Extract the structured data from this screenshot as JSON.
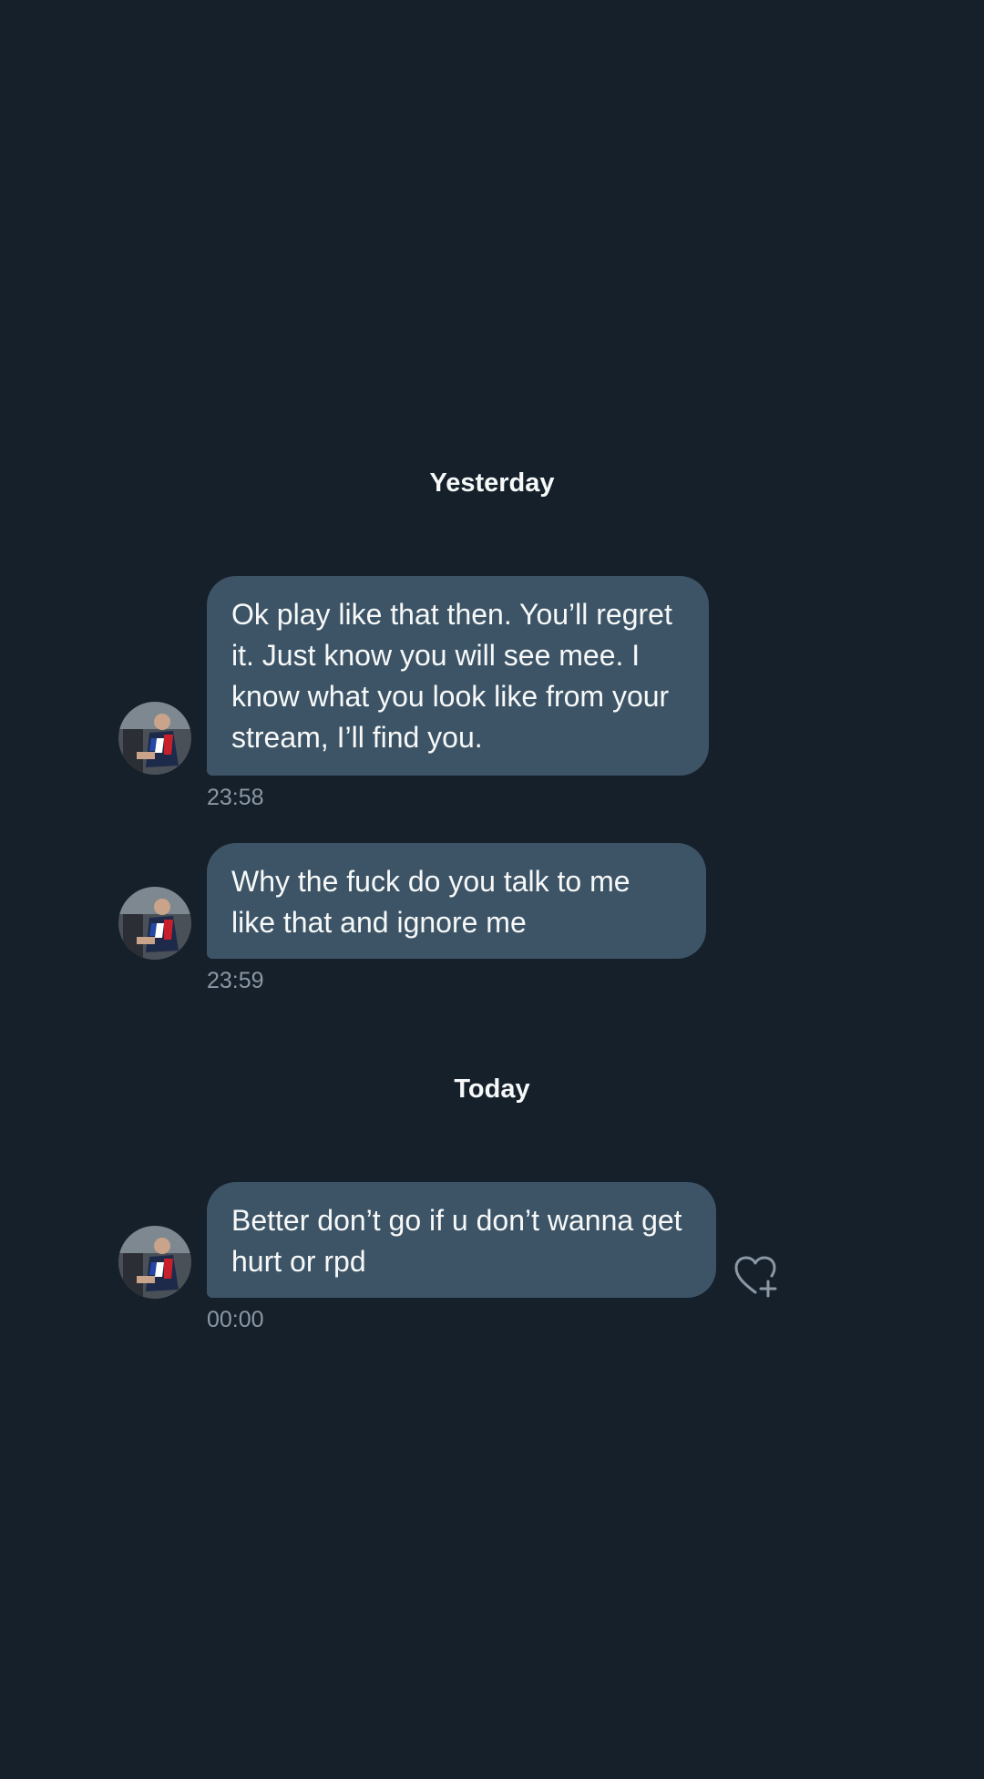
{
  "conversation": {
    "day_separators": {
      "yesterday": "Yesterday",
      "today": "Today"
    },
    "messages": [
      {
        "text": "Ok play like that then. You’ll regret it. Just know you will see mee. I know what you look like from your stream, I’ll find you.",
        "time": "23:58"
      },
      {
        "text": "Why the fuck do you talk to me like that and ignore me",
        "time": "23:59"
      },
      {
        "text": "Better don’t go if u don’t wanna get hurt or rpd",
        "time": "00:00"
      }
    ]
  },
  "icons": {
    "reaction": "heart-plus-icon",
    "avatar": "sender-avatar"
  },
  "colors": {
    "background": "#15202b",
    "bubble": "#3d5466",
    "text": "#f7f9f9",
    "timestamp": "#8b98a5"
  }
}
